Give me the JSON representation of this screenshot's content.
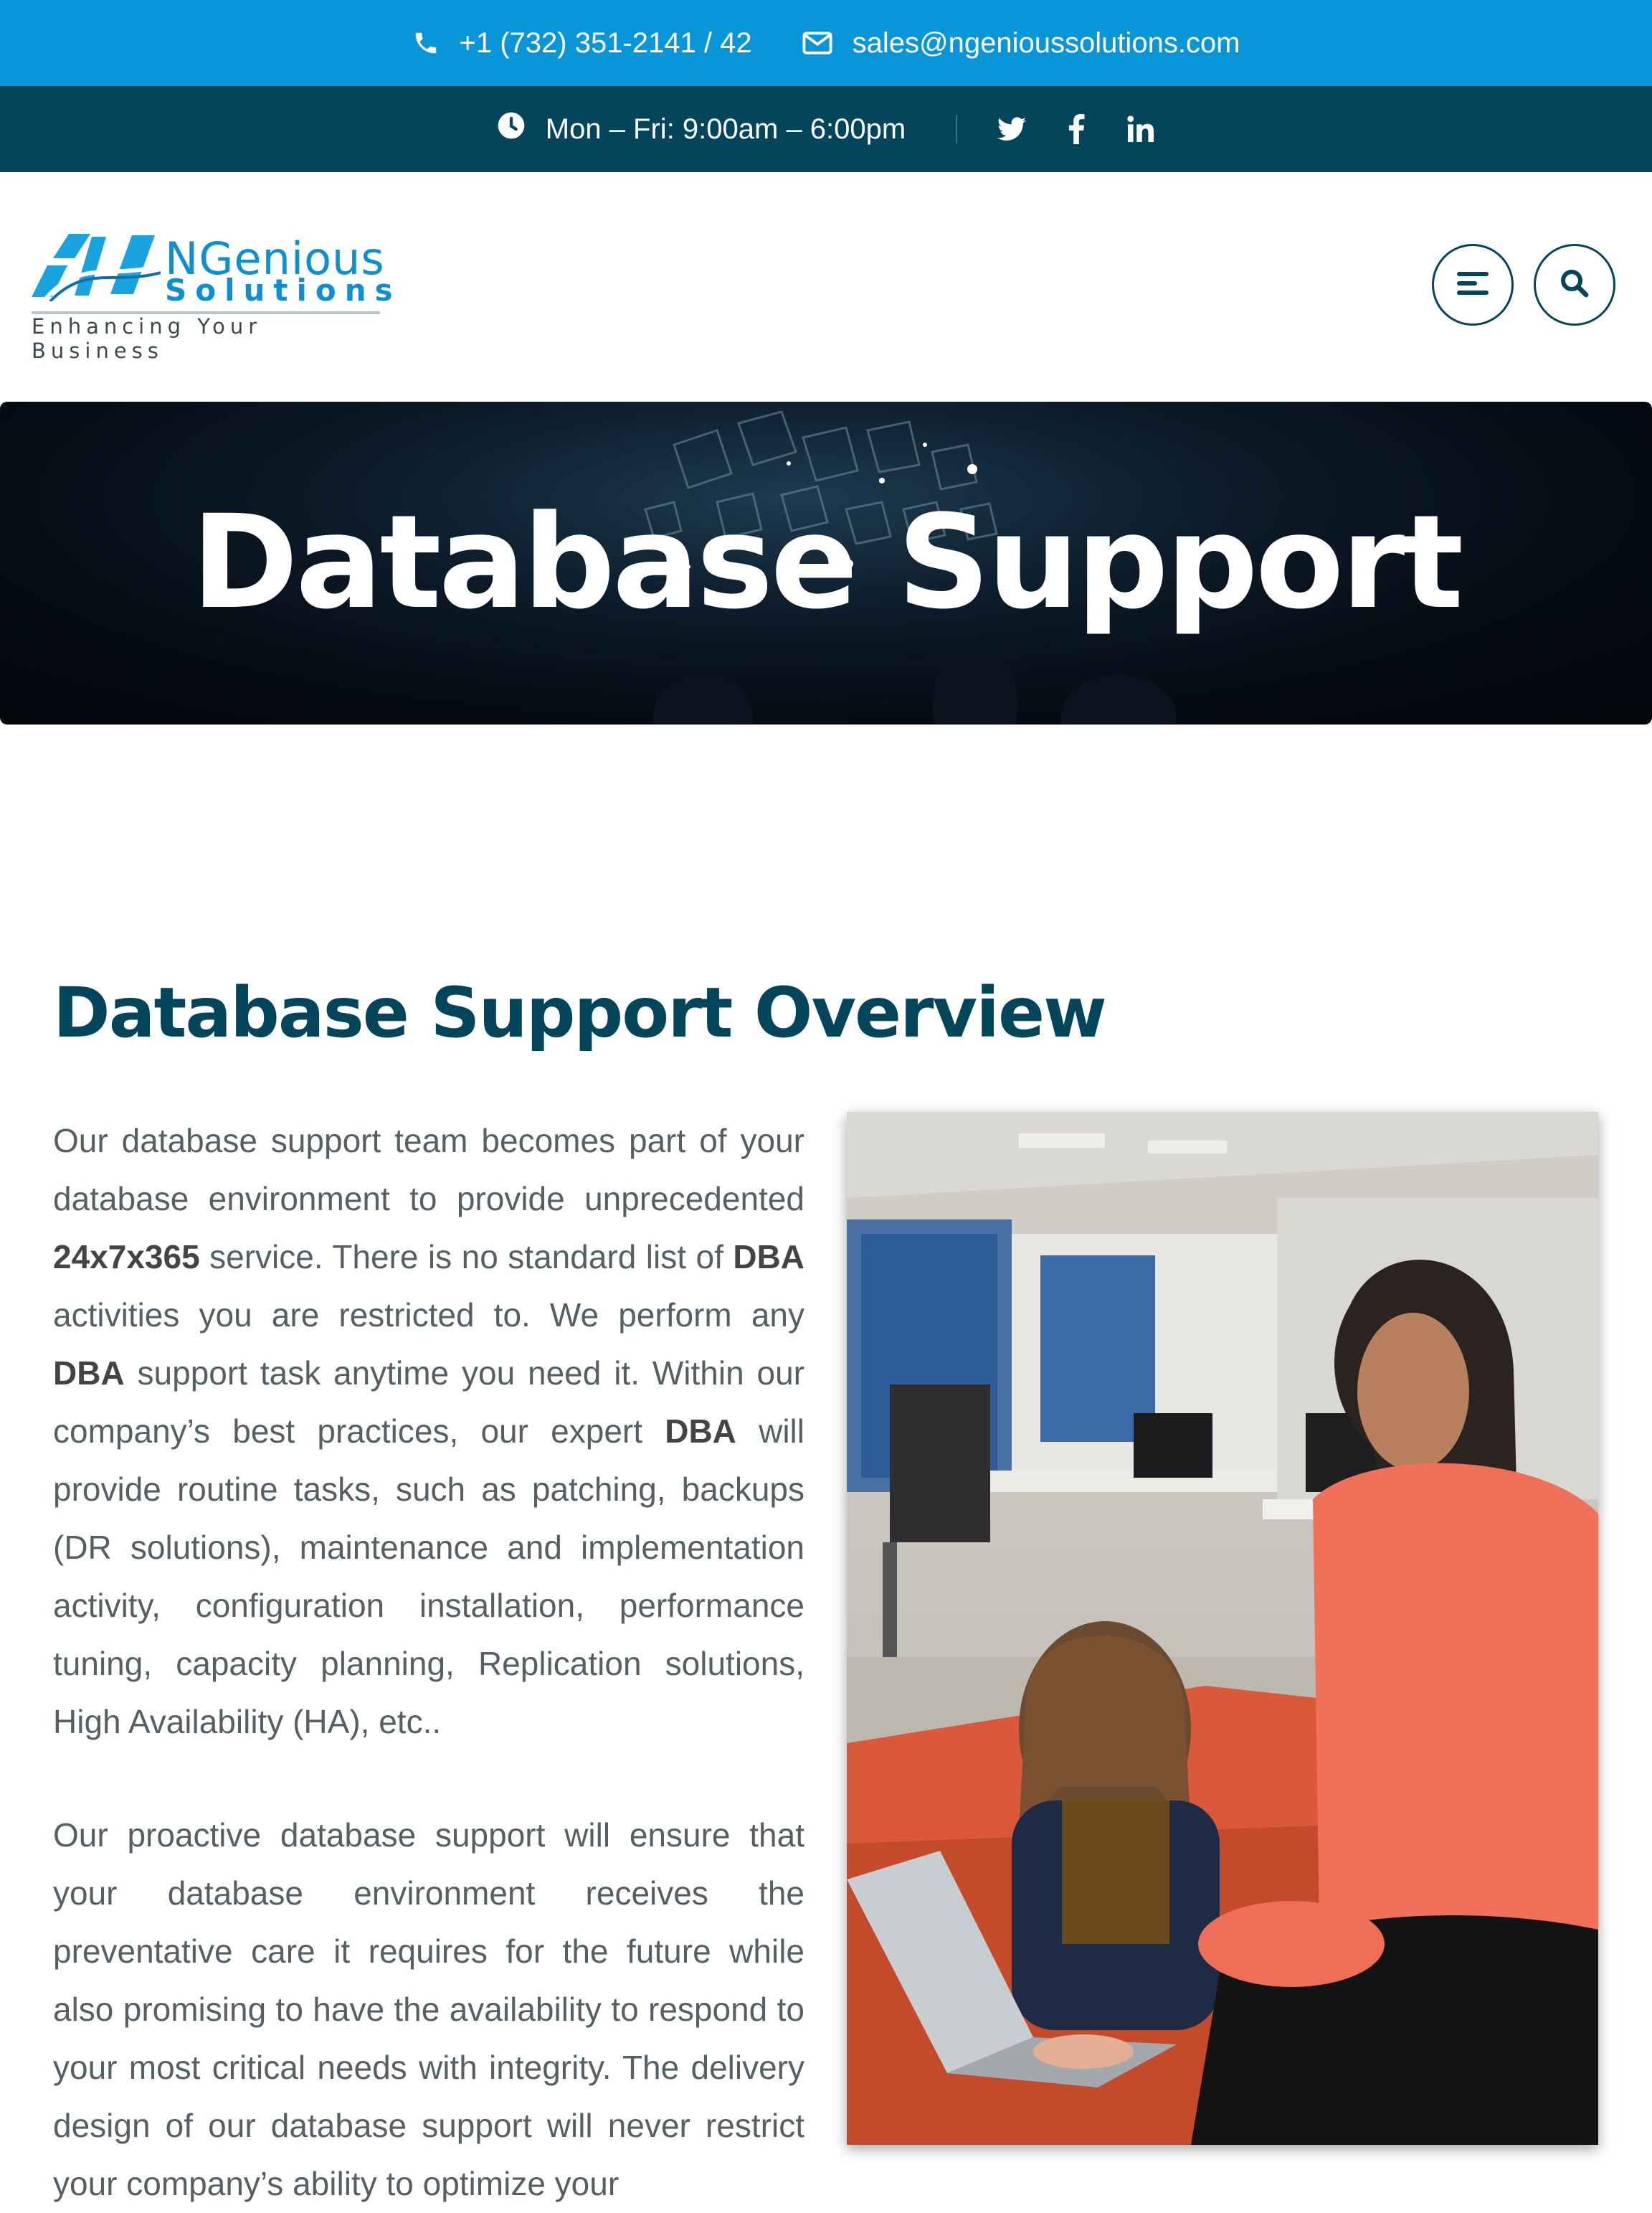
{
  "topbar": {
    "phone": "+1 (732) 351-2141 / 42",
    "email": "sales@ngenioussolutions.com",
    "bg_color": "#0996d8"
  },
  "secbar": {
    "hours": "Mon – Fri: 9:00am – 6:00pm",
    "social": [
      "twitter-icon",
      "facebook-icon",
      "linkedin-icon"
    ],
    "bg_color": "#03465c"
  },
  "logo": {
    "brand_main": "NGenious",
    "brand_sub": "Solutions",
    "tagline": "Enhancing Your Business"
  },
  "hero": {
    "title": "Database Support"
  },
  "overview": {
    "title": "Database Support Overview",
    "paragraph1": {
      "t1": "Our database support team becomes part of your database environment to provide unprecedented ",
      "b1": "24x7x365",
      "t2": " service. There is no standard list of ",
      "b2": "DBA",
      "t3": " activities you are restricted to. We perform any ",
      "b3": "DBA",
      "t4": " support task anytime you need it. Within our company’s best practices, our expert ",
      "b4": "DBA",
      "t5": " will provide routine tasks, such as patching, backups (DR solutions), maintenance and implementation activity, configuration installation, performance tuning, capacity planning, Replication solutions, High Availability (HA), etc.."
    },
    "paragraph2": "Our proactive database support will ensure that your database environment receives the preventative care it requires for the future while also promising to have the availability to respond to your most critical needs with integrity. The delivery design of our database support will never restrict your company’s ability to optimize your"
  },
  "colors": {
    "accent": "#0996d8",
    "dark_teal": "#03465c",
    "body_text": "#565f64"
  }
}
